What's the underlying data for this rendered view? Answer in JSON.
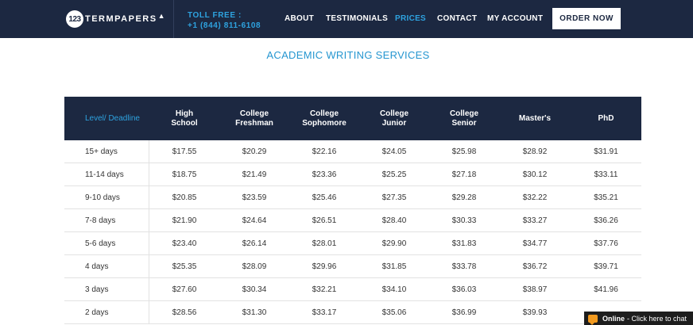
{
  "header": {
    "logo_number": "123",
    "logo_text": "TERMPAPERS",
    "toll_label": "TOLL FREE :",
    "toll_phone": "+1 (844) 811-6108",
    "nav": [
      "ABOUT",
      "TESTIMONIALS",
      "PRICES",
      "CONTACT",
      "MY ACCOUNT"
    ],
    "active_nav": "PRICES",
    "order_label": "ORDER NOW"
  },
  "page": {
    "title": "ACADEMIC WRITING SERVICES"
  },
  "pricing": {
    "headers": [
      "Level/ Deadline",
      "High School",
      "College Freshman",
      "College Sophomore",
      "College Junior",
      "College Senior",
      "Master's",
      "PhD"
    ],
    "rows": [
      [
        "15+ days",
        "$17.55",
        "$20.29",
        "$22.16",
        "$24.05",
        "$25.98",
        "$28.92",
        "$31.91"
      ],
      [
        "11-14 days",
        "$18.75",
        "$21.49",
        "$23.36",
        "$25.25",
        "$27.18",
        "$30.12",
        "$33.11"
      ],
      [
        "9-10 days",
        "$20.85",
        "$23.59",
        "$25.46",
        "$27.35",
        "$29.28",
        "$32.22",
        "$35.21"
      ],
      [
        "7-8 days",
        "$21.90",
        "$24.64",
        "$26.51",
        "$28.40",
        "$30.33",
        "$33.27",
        "$36.26"
      ],
      [
        "5-6 days",
        "$23.40",
        "$26.14",
        "$28.01",
        "$29.90",
        "$31.83",
        "$34.77",
        "$37.76"
      ],
      [
        "4 days",
        "$25.35",
        "$28.09",
        "$29.96",
        "$31.85",
        "$33.78",
        "$36.72",
        "$39.71"
      ],
      [
        "3 days",
        "$27.60",
        "$30.34",
        "$32.21",
        "$34.10",
        "$36.03",
        "$38.97",
        "$41.96"
      ],
      [
        "2 days",
        "$28.56",
        "$31.30",
        "$33.17",
        "$35.06",
        "$36.99",
        "$39.93",
        ""
      ]
    ]
  },
  "chat": {
    "status": "Online",
    "text": "- Click here to chat",
    "icon": "chat-bubble-icon"
  },
  "colors": {
    "navy": "#1c2841",
    "accent": "#2ea3e0",
    "chat_icon": "#f29a1f"
  }
}
